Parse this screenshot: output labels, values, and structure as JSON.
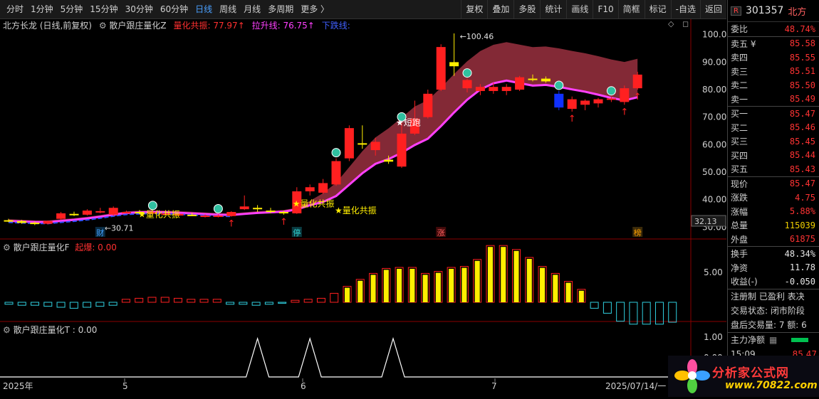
{
  "toolbar": {
    "periods": [
      "分时",
      "1分钟",
      "5分钟",
      "15分钟",
      "30分钟",
      "60分钟",
      "日线",
      "周线",
      "月线",
      "多周期",
      "更多 〉"
    ],
    "active_period": "日线",
    "buttons": [
      "复权",
      "叠加",
      "多股",
      "统计",
      "画线",
      "F10",
      "简框",
      "标记",
      "-自选",
      "返回"
    ]
  },
  "main_chart": {
    "title": "北方长龙 (日线,前复权)",
    "indicator_name": "散户跟庄量化Z",
    "resonance_label": "量化共振: 77.97↑",
    "uptrend_label": "拉升线: 76.75↑",
    "downtrend_label": "下跌线:",
    "price_axis": [
      "100.0",
      "90.00",
      "80.00",
      "70.00",
      "60.00",
      "50.00",
      "40.00",
      "30.00"
    ],
    "current_price_tag": "32.13",
    "high_annotation": "←100.46",
    "low_annotation": "←30.71",
    "signal_short": "★短跑",
    "signal_resonance": [
      "★量化共振",
      "★量化共振",
      "★量化共振"
    ],
    "markers": [
      "财",
      "停",
      "涨",
      "榜"
    ]
  },
  "chart_data": {
    "type": "candlestick",
    "ylim": [
      28,
      102
    ],
    "candles": [
      {
        "o": 32.5,
        "h": 33,
        "l": 31.8,
        "c": 32.0
      },
      {
        "o": 32.2,
        "h": 32.6,
        "l": 31.2,
        "c": 31.5
      },
      {
        "o": 31.6,
        "h": 32.0,
        "l": 30.71,
        "c": 31.2
      },
      {
        "o": 31.2,
        "h": 32.4,
        "l": 31.0,
        "c": 32.2
      },
      {
        "o": 33.0,
        "h": 35.5,
        "l": 32.5,
        "c": 35.0
      },
      {
        "o": 34.8,
        "h": 35.6,
        "l": 34.0,
        "c": 34.4
      },
      {
        "o": 34.5,
        "h": 36.5,
        "l": 34.2,
        "c": 36.0
      },
      {
        "o": 35.5,
        "h": 37.0,
        "l": 35.0,
        "c": 35.8
      },
      {
        "o": 34.5,
        "h": 37.5,
        "l": 34.0,
        "c": 37.0
      },
      {
        "o": 35.5,
        "h": 36.0,
        "l": 35.0,
        "c": 35.5
      },
      {
        "o": 35.5,
        "h": 36.2,
        "l": 34.8,
        "c": 35.2
      },
      {
        "o": 35.2,
        "h": 35.8,
        "l": 34.8,
        "c": 35.4
      },
      {
        "o": 34.5,
        "h": 35.3,
        "l": 34.2,
        "c": 35.0
      },
      {
        "o": 34.2,
        "h": 35.0,
        "l": 34.0,
        "c": 34.8
      },
      {
        "o": 34.5,
        "h": 35.2,
        "l": 34.0,
        "c": 34.3
      },
      {
        "o": 33.8,
        "h": 34.6,
        "l": 33.5,
        "c": 34.2
      },
      {
        "o": 33.8,
        "h": 34.6,
        "l": 33.5,
        "c": 34.2
      },
      {
        "o": 34.0,
        "h": 35.8,
        "l": 33.8,
        "c": 35.5
      },
      {
        "o": 36.5,
        "h": 41.5,
        "l": 36.2,
        "c": 37.5
      },
      {
        "o": 37.0,
        "h": 38.0,
        "l": 35.5,
        "c": 36.5
      },
      {
        "o": 36.0,
        "h": 37.0,
        "l": 35.0,
        "c": 35.5
      },
      {
        "o": 35.5,
        "h": 36.0,
        "l": 34.5,
        "c": 35.2
      },
      {
        "o": 35.0,
        "h": 44.5,
        "l": 34.8,
        "c": 43.0
      },
      {
        "o": 43.0,
        "h": 45.5,
        "l": 41.5,
        "c": 44.5
      },
      {
        "o": 42.5,
        "h": 47.5,
        "l": 42.0,
        "c": 46.0
      },
      {
        "o": 45.5,
        "h": 55.0,
        "l": 45.0,
        "c": 54.0
      },
      {
        "o": 55.0,
        "h": 67.0,
        "l": 54.0,
        "c": 66.0
      },
      {
        "o": 60.5,
        "h": 67.0,
        "l": 58.5,
        "c": 60.0
      },
      {
        "o": 58.0,
        "h": 62.5,
        "l": 56.0,
        "c": 61.0
      },
      {
        "o": 54.5,
        "h": 56.0,
        "l": 53.0,
        "c": 53.8
      },
      {
        "o": 52.0,
        "h": 68.0,
        "l": 51.5,
        "c": 64.0
      },
      {
        "o": 64.0,
        "h": 76.0,
        "l": 63.5,
        "c": 69.5
      },
      {
        "o": 70.0,
        "h": 80.0,
        "l": 69.5,
        "c": 78.5
      },
      {
        "o": 80.0,
        "h": 96.5,
        "l": 79.5,
        "c": 95.5
      },
      {
        "o": 90.0,
        "h": 100.46,
        "l": 85.0,
        "c": 88.5
      },
      {
        "o": 80.5,
        "h": 84.0,
        "l": 79.0,
        "c": 83.5
      },
      {
        "o": 79.5,
        "h": 82.0,
        "l": 78.0,
        "c": 81.0
      },
      {
        "o": 79.5,
        "h": 82.5,
        "l": 78.5,
        "c": 81.0
      },
      {
        "o": 79.5,
        "h": 82.0,
        "l": 78.0,
        "c": 81.0
      },
      {
        "o": 80.0,
        "h": 85.0,
        "l": 79.5,
        "c": 84.5
      },
      {
        "o": 84.0,
        "h": 85.5,
        "l": 83.0,
        "c": 83.5
      },
      {
        "o": 84.0,
        "h": 84.8,
        "l": 82.5,
        "c": 83.0
      },
      {
        "o": 78.5,
        "h": 79.5,
        "l": 72.5,
        "c": 73.5
      },
      {
        "o": 73.0,
        "h": 77.5,
        "l": 72.0,
        "c": 76.5
      },
      {
        "o": 74.5,
        "h": 76.5,
        "l": 72.5,
        "c": 76.0
      },
      {
        "o": 75.0,
        "h": 77.0,
        "l": 73.5,
        "c": 76.5
      },
      {
        "o": 76.5,
        "h": 77.5,
        "l": 75.5,
        "c": 76.8
      },
      {
        "o": 75.5,
        "h": 81.5,
        "l": 74.5,
        "c": 80.5
      },
      {
        "o": 80.5,
        "h": 86.5,
        "l": 80.0,
        "c": 85.47
      }
    ],
    "indicator_F": {
      "label": "散户跟庄量化F",
      "value_label": "起爆: 0.00",
      "axis": [
        "5.00"
      ],
      "bars": [
        -0.2,
        -0.3,
        -0.3,
        -0.4,
        -0.5,
        -0.6,
        -0.5,
        -0.4,
        -0.3,
        0.3,
        0.4,
        0.5,
        0.5,
        0.4,
        0.3,
        0.3,
        0.3,
        -0.2,
        -0.2,
        -0.3,
        -0.2,
        -0.1,
        0.2,
        0.3,
        0.4,
        0.9,
        1.6,
        2.3,
        2.9,
        3.4,
        3.5,
        3.5,
        2.9,
        3.1,
        3.5,
        3.6,
        4.3,
        5.7,
        5.7,
        5.3,
        4.5,
        3.6,
        2.9,
        2.1,
        1.3,
        -0.6,
        -1.1,
        -1.9,
        -2.2,
        -2.2,
        -2.2,
        -2.0
      ]
    },
    "indicator_T": {
      "label": "散户跟庄量化T",
      "value_label": ": 0.00",
      "axis": [
        "1.00",
        "0.00"
      ],
      "peaks": [
        19,
        23,
        30
      ]
    },
    "x_axis": [
      "2025年",
      "5",
      "6",
      "7",
      "2025/07/14/一"
    ]
  },
  "quote_panel": {
    "badge": "R",
    "code": "301357",
    "name": "北方",
    "rows": [
      {
        "label": "委比",
        "value": "48.74%",
        "color": "red"
      },
      {
        "label": "卖五 ¥",
        "value": "85.58",
        "color": "red"
      },
      {
        "label": "卖四",
        "value": "85.55",
        "color": "red"
      },
      {
        "label": "卖三",
        "value": "85.51",
        "color": "red"
      },
      {
        "label": "卖二",
        "value": "85.50",
        "color": "red"
      },
      {
        "label": "卖一",
        "value": "85.49",
        "color": "red"
      },
      {
        "label": "买一",
        "value": "85.47",
        "color": "red"
      },
      {
        "label": "买二",
        "value": "85.46",
        "color": "red"
      },
      {
        "label": "买三",
        "value": "85.45",
        "color": "red"
      },
      {
        "label": "买四",
        "value": "85.44",
        "color": "red"
      },
      {
        "label": "买五",
        "value": "85.43",
        "color": "red"
      },
      {
        "label": "现价",
        "value": "85.47",
        "color": "red"
      },
      {
        "label": "涨跌",
        "value": "4.75",
        "color": "red"
      },
      {
        "label": "涨幅",
        "value": "5.88%",
        "color": "red"
      },
      {
        "label": "总量",
        "value": "115039",
        "color": "yellow"
      },
      {
        "label": "外盘",
        "value": "61875",
        "color": "red"
      },
      {
        "label": "换手",
        "value": "48.34%",
        "color": "white"
      },
      {
        "label": "净资",
        "value": "11.78",
        "color": "white"
      },
      {
        "label": "收益(-)",
        "value": "-0.050",
        "color": "white"
      }
    ],
    "status_line": "注册制 已盈利 表决",
    "trade_status": "交易状态: 闭市阶段",
    "after_hours": "盘后交易量: 7  额: 6",
    "main_flow": "主力净额",
    "last_time": "15:09",
    "last_price": "85.47"
  },
  "watermark": {
    "logo_cn": "分析家公式网",
    "logo_url": "www.70822.com"
  }
}
